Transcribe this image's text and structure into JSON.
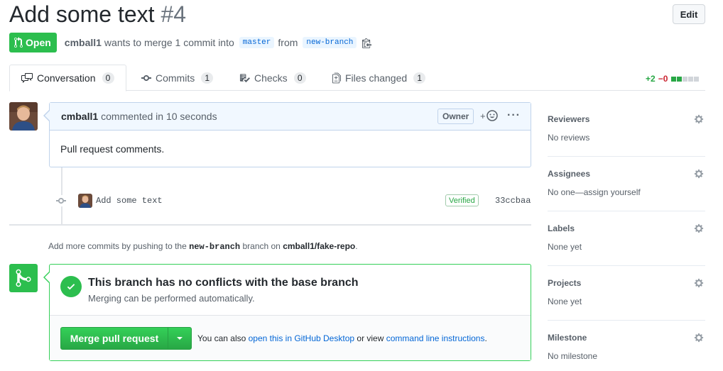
{
  "header": {
    "title": "Add some text",
    "number": "#4",
    "edit_label": "Edit"
  },
  "meta": {
    "state": "Open",
    "author": "cmball1",
    "action_text": "wants to merge 1 commit into",
    "base_branch": "master",
    "from_text": "from",
    "head_branch": "new-branch"
  },
  "tabs": [
    {
      "label": "Conversation",
      "count": "0",
      "icon": "comment-discussion-icon"
    },
    {
      "label": "Commits",
      "count": "1",
      "icon": "git-commit-icon"
    },
    {
      "label": "Checks",
      "count": "0",
      "icon": "checklist-icon"
    },
    {
      "label": "Files changed",
      "count": "1",
      "icon": "file-diff-icon"
    }
  ],
  "diffstat": {
    "additions": "+2",
    "deletions": "−0",
    "colors": {
      "add": "#28a745",
      "neutral": "#d1d5da"
    }
  },
  "comment": {
    "author": "cmball1",
    "time_text": "commented in 10 seconds",
    "role": "Owner",
    "reaction_label": "+",
    "body": "Pull request comments."
  },
  "commit": {
    "message": "Add some text",
    "verified": "Verified",
    "sha": "33ccbaa"
  },
  "push_hint": {
    "prefix": "Add more commits by pushing to the",
    "branch": "new-branch",
    "middle": "branch on",
    "repo": "cmball1/fake-repo",
    "suffix": "."
  },
  "merge": {
    "title": "This branch has no conflicts with the base branch",
    "subtitle": "Merging can be performed automatically.",
    "button_label": "Merge pull request",
    "alt_prefix": "You can also",
    "desktop_link": "open this in GitHub Desktop",
    "alt_middle": "or view",
    "cli_link": "command line instructions",
    "alt_suffix": ".",
    "accent": "#2cbe4e"
  },
  "sidebar": {
    "sections": [
      {
        "title": "Reviewers",
        "value": "No reviews"
      },
      {
        "title": "Assignees",
        "value": "No one—assign yourself"
      },
      {
        "title": "Labels",
        "value": "None yet"
      },
      {
        "title": "Projects",
        "value": "None yet"
      },
      {
        "title": "Milestone",
        "value": "No milestone"
      }
    ]
  }
}
